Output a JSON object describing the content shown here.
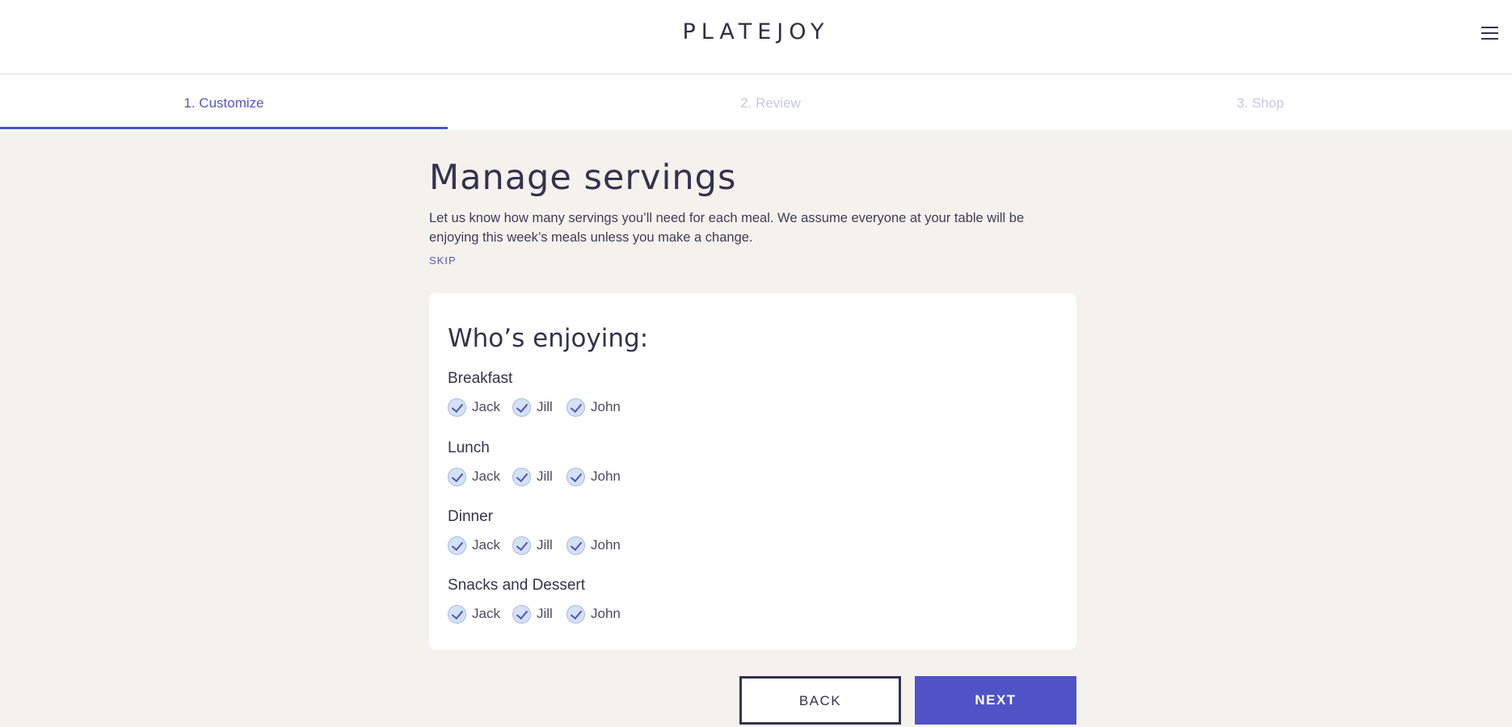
{
  "header": {
    "logo_text": "PLATEJOY",
    "menu_icon": "hamburger-menu-icon"
  },
  "steps": [
    {
      "label": "1. Customize",
      "active": true
    },
    {
      "label": "2. Review",
      "active": false
    },
    {
      "label": "3. Shop",
      "active": false
    }
  ],
  "main": {
    "title": "Manage servings",
    "description": "Let us know how many servings you’ll need for each meal. We assume everyone at your table will be enjoying this week’s meals unless you make a change.",
    "skip_label": "SKIP"
  },
  "card": {
    "title": "Who’s enjoying:",
    "meals": [
      {
        "label": "Breakfast",
        "people": [
          {
            "name": "Jack",
            "checked": true
          },
          {
            "name": "Jill",
            "checked": true
          },
          {
            "name": "John",
            "checked": true
          }
        ]
      },
      {
        "label": "Lunch",
        "people": [
          {
            "name": "Jack",
            "checked": true
          },
          {
            "name": "Jill",
            "checked": true
          },
          {
            "name": "John",
            "checked": true
          }
        ]
      },
      {
        "label": "Dinner",
        "people": [
          {
            "name": "Jack",
            "checked": true
          },
          {
            "name": "Jill",
            "checked": true
          },
          {
            "name": "John",
            "checked": true
          }
        ]
      },
      {
        "label": "Snacks and Dessert",
        "people": [
          {
            "name": "Jack",
            "checked": true
          },
          {
            "name": "Jill",
            "checked": true
          },
          {
            "name": "John",
            "checked": true
          }
        ]
      }
    ]
  },
  "buttons": {
    "back_label": "BACK",
    "next_label": "NEXT"
  },
  "colors": {
    "accent": "#4f53c5",
    "background": "#f5f2ee",
    "text": "#33334d",
    "inactive_step": "#c6c7e8"
  }
}
